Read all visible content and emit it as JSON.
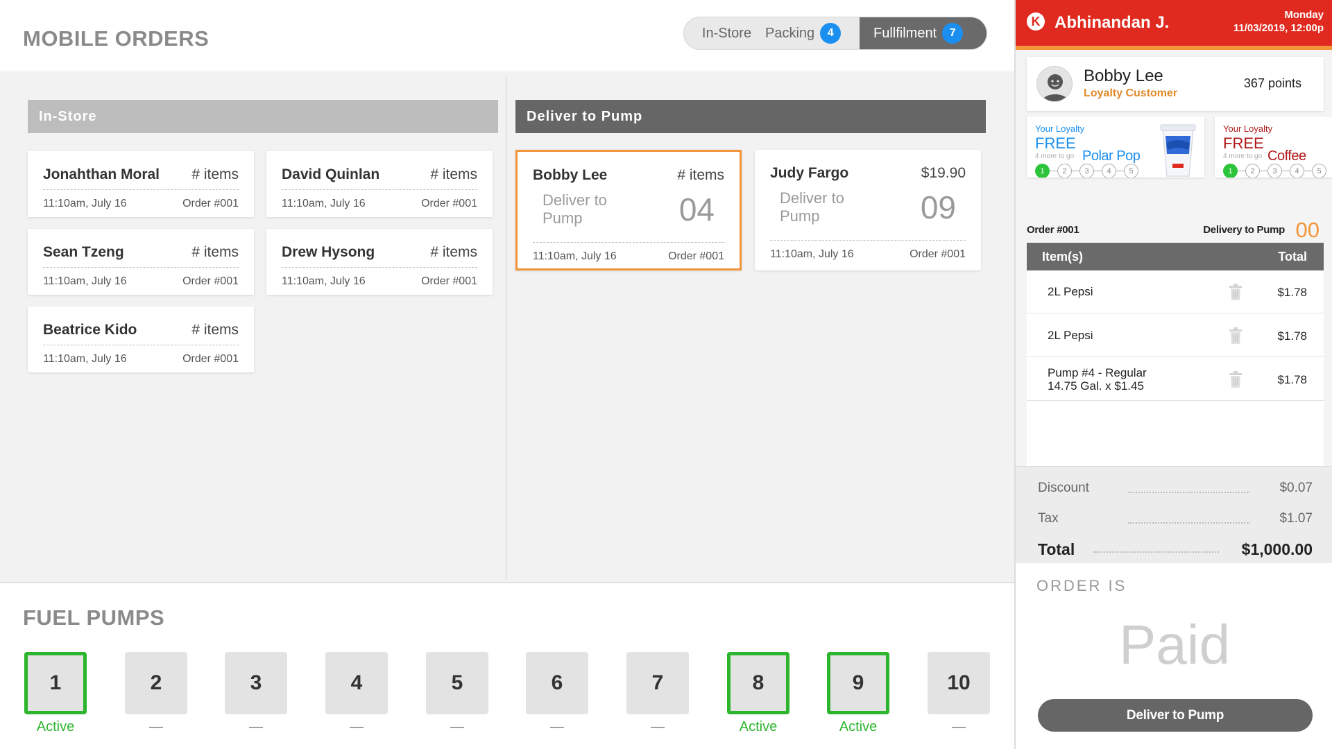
{
  "header": {
    "title": "MOBILE ORDERS"
  },
  "tabs": {
    "instore": {
      "label": "In-Store"
    },
    "packing": {
      "label": "Packing",
      "count": "4"
    },
    "fulfillment": {
      "label": "Fullfilment",
      "count": "7"
    }
  },
  "columns": {
    "instore": "In-Store",
    "pump": "Deliver to Pump"
  },
  "instore_orders": [
    {
      "name": "Jonahthan Moral",
      "items": "# items",
      "time": "11:10am, July 16",
      "order": "Order #001"
    },
    {
      "name": "David Quinlan",
      "items": "# items",
      "time": "11:10am, July 16",
      "order": "Order #001"
    },
    {
      "name": "Sean Tzeng",
      "items": "# items",
      "time": "11:10am, July 16",
      "order": "Order #001"
    },
    {
      "name": "Drew Hysong",
      "items": "# items",
      "time": "11:10am, July 16",
      "order": "Order #001"
    },
    {
      "name": "Beatrice Kido",
      "items": "# items",
      "time": "11:10am, July 16",
      "order": "Order #001"
    }
  ],
  "pump_orders": [
    {
      "name": "Bobby Lee",
      "items": "# items",
      "deliver": "Deliver to Pump",
      "pump": "04",
      "time": "11:10am, July 16",
      "order": "Order #001",
      "selected": true
    },
    {
      "name": "Judy Fargo",
      "items": "$19.90",
      "deliver": "Deliver to Pump",
      "pump": "09",
      "time": "11:10am, July 16",
      "order": "Order #001",
      "selected": false
    }
  ],
  "fuel": {
    "title": "FUEL PUMPS",
    "pumps": [
      {
        "num": "1",
        "status": "Active",
        "active": true
      },
      {
        "num": "2",
        "status": "—",
        "active": false
      },
      {
        "num": "3",
        "status": "—",
        "active": false
      },
      {
        "num": "4",
        "status": "—",
        "active": false
      },
      {
        "num": "5",
        "status": "—",
        "active": false
      },
      {
        "num": "6",
        "status": "—",
        "active": false
      },
      {
        "num": "7",
        "status": "—",
        "active": false
      },
      {
        "num": "8",
        "status": "Active",
        "active": true
      },
      {
        "num": "9",
        "status": "Active",
        "active": true
      },
      {
        "num": "10",
        "status": "—",
        "active": false
      }
    ]
  },
  "panel": {
    "brand_letter": "K",
    "cashier": "Abhinandan J.",
    "day": "Monday",
    "datetime": "11/03/2019, 12:00p",
    "customer": {
      "name": "Bobby Lee",
      "type": "Loyalty Customer",
      "points": "367 points"
    },
    "loyalty": [
      {
        "label": "Your Loyalty",
        "free": "FREE",
        "more": "4 more to go",
        "product": "Polar Pop",
        "color": "#1a8ff0",
        "dots": [
          "1",
          "2",
          "3",
          "4",
          "5"
        ],
        "done": 1
      },
      {
        "label": "Your Loyalty",
        "free": "FREE",
        "more": "4 more to go",
        "product": "Coffee",
        "color": "#b01818",
        "dots": [
          "1",
          "2",
          "3",
          "4",
          "5"
        ],
        "done": 1
      }
    ],
    "order": {
      "number": "Order #001",
      "type": "Delivery to Pump",
      "count": "00"
    },
    "items_header": {
      "item": "Item(s)",
      "total": "Total"
    },
    "items": [
      {
        "line1": "2L Pepsi",
        "line2": "",
        "price": "$1.78"
      },
      {
        "line1": "2L Pepsi",
        "line2": "",
        "price": "$1.78"
      },
      {
        "line1": "Pump #4 - Regular",
        "line2": "14.75 Gal. x $1.45",
        "price": "$1.78"
      }
    ],
    "totals": {
      "discount_label": "Discount",
      "discount": "$0.07",
      "tax_label": "Tax",
      "tax": "$1.07",
      "total_label": "Total",
      "total": "$1,000.00"
    },
    "status_label": "ORDER IS",
    "status": "Paid",
    "action": "Deliver to Pump"
  },
  "colors": {
    "accent_orange": "#f2953a",
    "brand_red": "#e12a1f",
    "active_green": "#2db52d",
    "badge_blue": "#1a8ff0"
  }
}
